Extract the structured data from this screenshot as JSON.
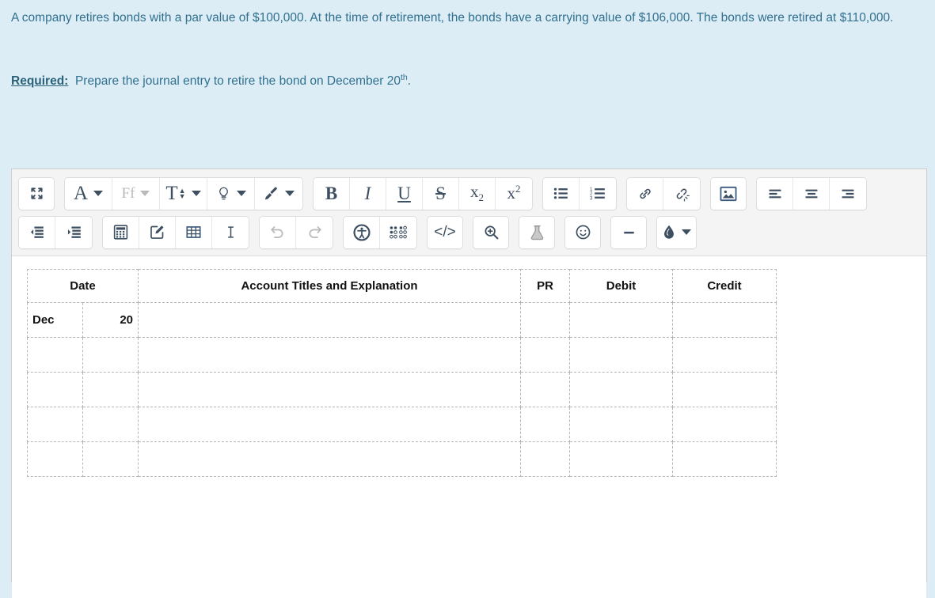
{
  "prompt": {
    "paragraph1": "A company retires bonds with a par value of $100,000.  At the time of retirement, the bonds have a carrying value of $106,000. The bonds were retired at $110,000.",
    "required_label": "Required:",
    "required_text_before": "Prepare the journal entry to retire the bond on December 20",
    "required_superscript": "th",
    "required_text_after": "."
  },
  "colors": {
    "page_background": "#dcedf6",
    "prompt_text": "#31708f",
    "toolbar_background": "#f4f4f4",
    "icon": "#3d4f61",
    "icon_disabled": "#b9b9b9",
    "table_border": "#b6b6b6",
    "editor_background": "#ffffff"
  },
  "toolbar": {
    "row1": [
      {
        "group": "fullscreen",
        "buttons": [
          {
            "name": "fullscreen-icon",
            "label": "Fullscreen",
            "icon": "arrows-expand",
            "caret": false,
            "disabled": false
          }
        ]
      },
      {
        "group": "text-format",
        "buttons": [
          {
            "name": "paragraph-style-icon",
            "label": "A",
            "icon": "letter-A",
            "caret": true,
            "disabled": false
          },
          {
            "name": "font-family-icon",
            "label": "Ff",
            "icon": "letter-Ff",
            "caret": true,
            "disabled": true
          },
          {
            "name": "font-size-icon",
            "label": "T",
            "icon": "letter-T-updown",
            "caret": true,
            "disabled": false
          },
          {
            "name": "highlight-color-icon",
            "label": "Highlight color",
            "icon": "lightbulb",
            "caret": true,
            "disabled": false
          },
          {
            "name": "text-color-icon",
            "label": "Text color",
            "icon": "paintbrush",
            "caret": true,
            "disabled": false
          }
        ]
      },
      {
        "group": "character-format",
        "buttons": [
          {
            "name": "bold-button",
            "label": "B",
            "icon": "bold",
            "caret": false,
            "disabled": false
          },
          {
            "name": "italic-button",
            "label": "I",
            "icon": "italic",
            "caret": false,
            "disabled": false
          },
          {
            "name": "underline-button",
            "label": "U",
            "icon": "underline",
            "caret": false,
            "disabled": false
          },
          {
            "name": "strikethrough-button",
            "label": "S",
            "icon": "strikethrough",
            "caret": false,
            "disabled": false
          },
          {
            "name": "subscript-button",
            "label": "x₂",
            "icon": "subscript",
            "caret": false,
            "disabled": false
          },
          {
            "name": "superscript-button",
            "label": "x²",
            "icon": "superscript",
            "caret": false,
            "disabled": false
          }
        ]
      },
      {
        "group": "lists",
        "buttons": [
          {
            "name": "bulleted-list-icon",
            "label": "Bulleted list",
            "icon": "bullet-list",
            "caret": false,
            "disabled": false
          },
          {
            "name": "numbered-list-icon",
            "label": "Numbered list",
            "icon": "numbered-list",
            "caret": false,
            "disabled": false
          }
        ]
      },
      {
        "group": "link",
        "buttons": [
          {
            "name": "insert-link-icon",
            "label": "Insert link",
            "icon": "chain-link",
            "caret": false,
            "disabled": false
          },
          {
            "name": "remove-link-icon",
            "label": "Remove link",
            "icon": "broken-link",
            "caret": false,
            "disabled": false
          }
        ]
      },
      {
        "group": "media",
        "buttons": [
          {
            "name": "insert-image-icon",
            "label": "Insert image",
            "icon": "picture",
            "caret": false,
            "disabled": false
          }
        ]
      },
      {
        "group": "alignment",
        "buttons": [
          {
            "name": "align-left-icon",
            "label": "Align left",
            "icon": "align-left",
            "caret": false,
            "disabled": false
          },
          {
            "name": "align-center-icon",
            "label": "Align center",
            "icon": "align-center",
            "caret": false,
            "disabled": false
          },
          {
            "name": "align-right-icon",
            "label": "Align right",
            "icon": "align-right",
            "caret": false,
            "disabled": false
          }
        ]
      }
    ],
    "row2": [
      {
        "group": "indentation",
        "buttons": [
          {
            "name": "outdent-icon",
            "label": "Decrease indent",
            "icon": "outdent",
            "caret": false,
            "disabled": false
          },
          {
            "name": "indent-icon",
            "label": "Increase indent",
            "icon": "indent",
            "caret": false,
            "disabled": false
          }
        ]
      },
      {
        "group": "insert-objects",
        "buttons": [
          {
            "name": "calculator-icon",
            "label": "Calculator",
            "icon": "calculator",
            "caret": false,
            "disabled": false
          },
          {
            "name": "edit-box-icon",
            "label": "Edit box",
            "icon": "pencil-box",
            "caret": false,
            "disabled": false
          },
          {
            "name": "insert-table-icon",
            "label": "Insert table",
            "icon": "table-grid",
            "caret": false,
            "disabled": false
          },
          {
            "name": "text-cursor-icon",
            "label": "Text cursor",
            "icon": "i-beam",
            "caret": false,
            "disabled": false
          }
        ]
      },
      {
        "group": "history",
        "buttons": [
          {
            "name": "undo-icon",
            "label": "Undo",
            "icon": "undo-arrow",
            "caret": false,
            "disabled": true
          },
          {
            "name": "redo-icon",
            "label": "Redo",
            "icon": "redo-arrow",
            "caret": false,
            "disabled": true
          }
        ]
      },
      {
        "group": "accessibility",
        "buttons": [
          {
            "name": "accessibility-checker-icon",
            "label": "Accessibility checker",
            "icon": "accessibility-person",
            "caret": false,
            "disabled": false
          },
          {
            "name": "braille-icon",
            "label": "Braille",
            "icon": "braille-dots",
            "caret": false,
            "disabled": false
          }
        ]
      },
      {
        "group": "source-code",
        "buttons": [
          {
            "name": "code-view-icon",
            "label": "</>",
            "icon": "code-brackets",
            "caret": false,
            "disabled": false
          }
        ]
      },
      {
        "group": "preview",
        "buttons": [
          {
            "name": "zoom-preview-icon",
            "label": "Preview",
            "icon": "magnifier-plus",
            "caret": false,
            "disabled": false
          }
        ]
      },
      {
        "group": "chemistry",
        "buttons": [
          {
            "name": "chemistry-flask-icon",
            "label": "Chemistry",
            "icon": "flask",
            "caret": false,
            "disabled": true
          }
        ]
      },
      {
        "group": "emoji",
        "buttons": [
          {
            "name": "emoji-icon",
            "label": "Emoji",
            "icon": "smiley-face",
            "caret": false,
            "disabled": false
          }
        ]
      },
      {
        "group": "horizontal-rule",
        "buttons": [
          {
            "name": "horizontal-rule-icon",
            "label": "Horizontal rule",
            "icon": "dash",
            "caret": false,
            "disabled": false
          }
        ]
      },
      {
        "group": "ink",
        "buttons": [
          {
            "name": "ink-droplet-icon",
            "label": "Ink",
            "icon": "droplet",
            "caret": true,
            "disabled": false
          }
        ]
      }
    ]
  },
  "journal_table": {
    "headers": [
      {
        "label": "Date",
        "colspan": 2
      },
      {
        "label": "Account Titles and Explanation",
        "colspan": 1
      },
      {
        "label": "PR",
        "colspan": 1
      },
      {
        "label": "Debit",
        "colspan": 1
      },
      {
        "label": "Credit",
        "colspan": 1
      }
    ],
    "rows": [
      {
        "month": "Dec",
        "day": "20",
        "account": "",
        "pr": "",
        "debit": "",
        "credit": ""
      },
      {
        "month": "",
        "day": "",
        "account": "",
        "pr": "",
        "debit": "",
        "credit": ""
      },
      {
        "month": "",
        "day": "",
        "account": "",
        "pr": "",
        "debit": "",
        "credit": ""
      },
      {
        "month": "",
        "day": "",
        "account": "",
        "pr": "",
        "debit": "",
        "credit": ""
      },
      {
        "month": "",
        "day": "",
        "account": "",
        "pr": "",
        "debit": "",
        "credit": ""
      }
    ]
  }
}
